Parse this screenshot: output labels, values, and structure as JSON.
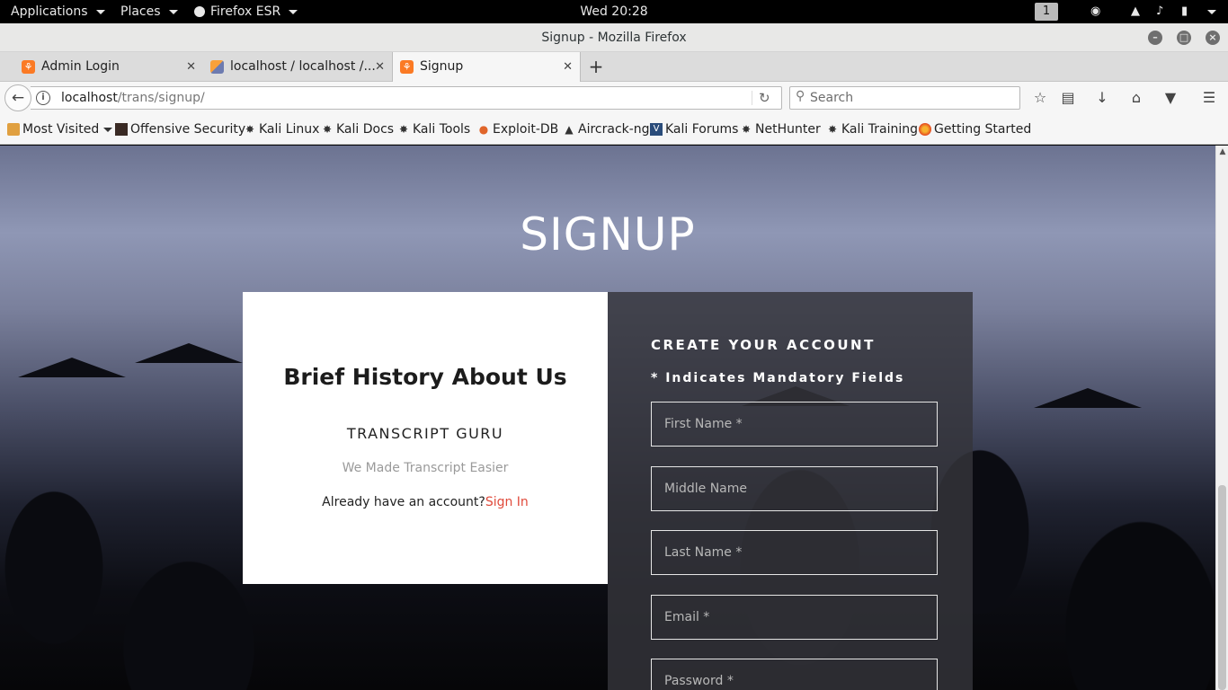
{
  "topbar": {
    "applications": "Applications",
    "places": "Places",
    "firefox": "Firefox ESR",
    "clock": "Wed 20:28",
    "workspace": "1",
    "icons": [
      "video-icon",
      "wifi-icon",
      "volume-icon",
      "battery-icon",
      "system-menu-icon"
    ]
  },
  "window": {
    "title": "Signup - Mozilla Firefox",
    "controls": [
      "minimize-icon",
      "maximize-icon",
      "close-icon"
    ]
  },
  "tabs": [
    {
      "label": "Admin Login",
      "favicon": "xampp-icon"
    },
    {
      "label": "localhost / localhost /...",
      "favicon": "phpmyadmin-icon"
    },
    {
      "label": "Signup",
      "favicon": "xampp-icon",
      "active": true
    }
  ],
  "navbar": {
    "url_host": "localhost",
    "url_path": "/trans/signup/",
    "search_placeholder": "Search"
  },
  "bookmarks": [
    "Most Visited",
    "Offensive Security",
    "Kali Linux",
    "Kali Docs",
    "Kali Tools",
    "Exploit-DB",
    "Aircrack-ng",
    "Kali Forums",
    "NetHunter",
    "Kali Training",
    "Getting Started"
  ],
  "page": {
    "title": "SIGNUP",
    "about": {
      "heading": "Brief History About Us",
      "brand": "TRANSCRIPT GURU",
      "tagline": "We Made Transcript Easier",
      "account_prompt": "Already have an account?",
      "sign_in": "Sign In"
    },
    "form": {
      "heading": "CREATE YOUR ACCOUNT",
      "mandatory_note": "* Indicates Mandatory Fields",
      "fields": {
        "first_name": "First Name *",
        "middle_name": "Middle Name",
        "last_name": "Last Name *",
        "email": "Email *",
        "password": "Password *"
      }
    }
  },
  "colors": {
    "link_accent": "#e04a3b",
    "form_panel": "#34343a"
  }
}
